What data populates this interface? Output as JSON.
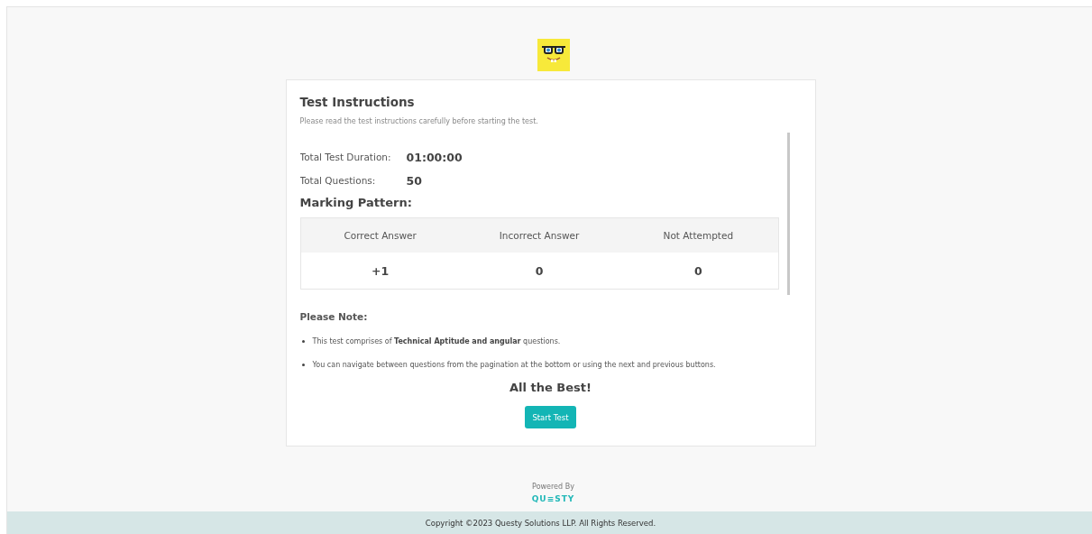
{
  "header": {
    "title": "Test Instructions",
    "subtitle": "Please read the test instructions carefully before starting the test."
  },
  "summary": [
    {
      "label": "Total Test Duration:",
      "value": "01:00:00"
    },
    {
      "label": "Total Questions:",
      "value": "50"
    }
  ],
  "marking": {
    "title": "Marking Pattern:",
    "columns": [
      "Correct Answer",
      "Incorrect Answer",
      "Not Attempted"
    ],
    "values": [
      "+1",
      "0",
      "0"
    ]
  },
  "notes": {
    "title": "Please Note:",
    "items": [
      "This test comprises of **Technical Aptitude and angular** questions.",
      "You can navigate between questions from the pagination at the bottom or using the next and previous buttons."
    ]
  },
  "closing": "All the Best!",
  "start_button": "Start Test",
  "powered_by": "Powered By",
  "brand": "QU≡STY",
  "copyright": "Copyright ©2023 Questy Solutions LLP. All Rights Reserved."
}
